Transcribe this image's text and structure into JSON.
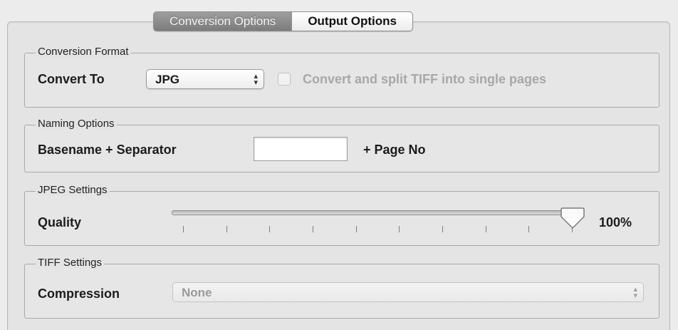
{
  "tabs": {
    "active_label": "Conversion Options",
    "inactive_label": "Output Options"
  },
  "conversion_format": {
    "group_title": "Conversion Format",
    "convert_to_label": "Convert To",
    "convert_to_value": "JPG",
    "split_tiff_label": "Convert and split TIFF into single pages",
    "split_tiff_checked": false,
    "split_tiff_enabled": false
  },
  "naming_options": {
    "group_title": "Naming Options",
    "basename_label": "Basename + Separator",
    "separator_value": "",
    "suffix_label": "+ Page No"
  },
  "jpeg_settings": {
    "group_title": "JPEG Settings",
    "quality_label": "Quality",
    "quality_value": 100,
    "quality_text": "100%",
    "tick_count": 10
  },
  "tiff_settings": {
    "group_title": "TIFF Settings",
    "compression_label": "Compression",
    "compression_value": "None",
    "compression_enabled": false
  },
  "icons": {
    "popup_arrows": "up-down-chevron-icon",
    "slider_knob": "slider-knob-icon"
  }
}
